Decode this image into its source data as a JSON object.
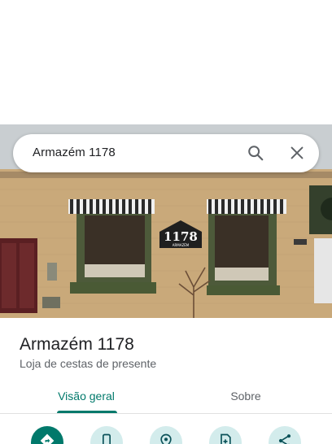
{
  "search": {
    "query": "Armazém 1178"
  },
  "photo": {
    "sign_number": "1178",
    "sign_word": "ARMAZÉM"
  },
  "place": {
    "name": "Armazém 1178",
    "category": "Loja de cestas de presente"
  },
  "tabs": [
    {
      "label": "Visão geral",
      "active": true
    },
    {
      "label": "Sobre",
      "active": false
    }
  ],
  "actions": [
    {
      "icon": "directions-icon",
      "primary": true
    },
    {
      "icon": "phone-icon"
    },
    {
      "icon": "location-pin-icon"
    },
    {
      "icon": "save-icon"
    },
    {
      "icon": "share-icon"
    }
  ],
  "colors": {
    "accent": "#00796b",
    "action_bg": "#d3ecec"
  }
}
